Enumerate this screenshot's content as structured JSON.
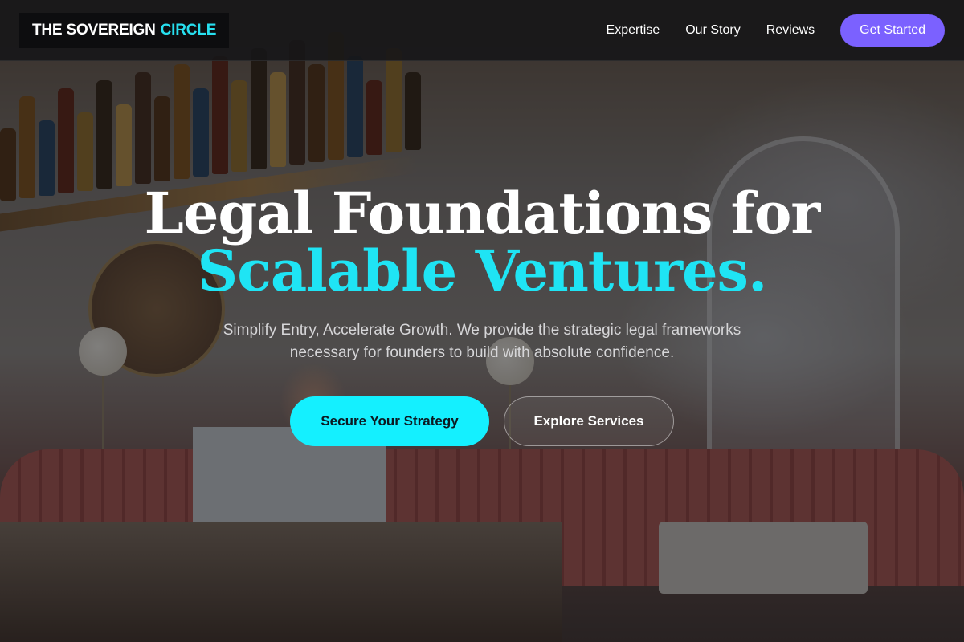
{
  "brand": {
    "name_main": "THE SOVEREIGN",
    "name_accent": "CIRCLE"
  },
  "nav": {
    "links": [
      {
        "label": "Expertise"
      },
      {
        "label": "Our Story"
      },
      {
        "label": "Reviews"
      }
    ],
    "cta_label": "Get Started"
  },
  "hero": {
    "headline_line1": "Legal Foundations for",
    "headline_line2": "Scalable Ventures.",
    "subhead": "Simplify Entry, Accelerate Growth. We provide the strategic legal frameworks necessary for founders to build with absolute confidence.",
    "primary_cta": "Secure Your Strategy",
    "secondary_cta": "Explore Services"
  },
  "colors": {
    "accent_cyan": "#14f0ff",
    "accent_purple": "#7b61ff",
    "nav_bg": "#161618"
  }
}
